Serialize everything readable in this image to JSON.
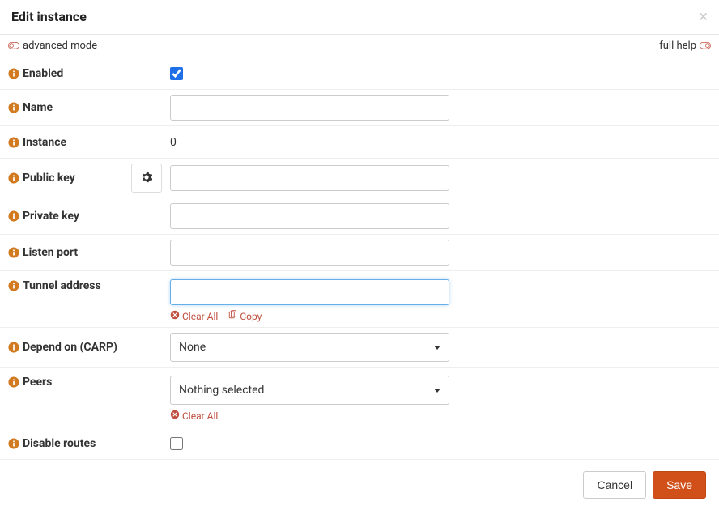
{
  "header": {
    "title": "Edit instance"
  },
  "topbar": {
    "advanced": "advanced mode",
    "fullhelp": "full help"
  },
  "fields": {
    "enabled": {
      "label": "Enabled",
      "checked": true
    },
    "name": {
      "label": "Name",
      "value": ""
    },
    "instance": {
      "label": "Instance",
      "value": "0"
    },
    "pubkey": {
      "label": "Public key",
      "value": ""
    },
    "privkey": {
      "label": "Private key",
      "value": ""
    },
    "listenport": {
      "label": "Listen port",
      "value": ""
    },
    "tunnel": {
      "label": "Tunnel address",
      "value": "",
      "clear": "Clear All",
      "copy": "Copy"
    },
    "carp": {
      "label": "Depend on (CARP)",
      "selected": "None"
    },
    "peers": {
      "label": "Peers",
      "selected": "Nothing selected",
      "clear": "Clear All"
    },
    "disableroutes": {
      "label": "Disable routes",
      "checked": false
    }
  },
  "footer": {
    "cancel": "Cancel",
    "save": "Save"
  }
}
